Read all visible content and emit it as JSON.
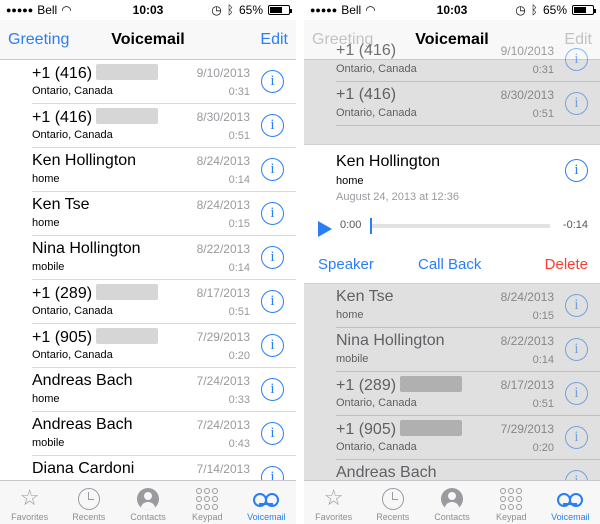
{
  "status": {
    "carrier": "Bell",
    "time": "10:03",
    "battery": "65%"
  },
  "left": {
    "nav": {
      "left": "Greeting",
      "title": "Voicemail",
      "right": "Edit"
    },
    "rows": [
      {
        "name": "+1 (416)",
        "blurred": true,
        "sub": "Ontario, Canada",
        "date": "9/10/2013",
        "dur": "0:31"
      },
      {
        "name": "+1 (416)",
        "blurred": true,
        "sub": "Ontario, Canada",
        "date": "8/30/2013",
        "dur": "0:51"
      },
      {
        "name": "Ken Hollington",
        "blurred": false,
        "sub": "home",
        "date": "8/24/2013",
        "dur": "0:14"
      },
      {
        "name": "Ken Tse",
        "blurred": false,
        "sub": "home",
        "date": "8/24/2013",
        "dur": "0:15"
      },
      {
        "name": "Nina Hollington",
        "blurred": false,
        "sub": "mobile",
        "date": "8/22/2013",
        "dur": "0:14"
      },
      {
        "name": "+1 (289)",
        "blurred": true,
        "sub": "Ontario, Canada",
        "date": "8/17/2013",
        "dur": "0:51"
      },
      {
        "name": "+1 (905)",
        "blurred": true,
        "sub": "Ontario, Canada",
        "date": "7/29/2013",
        "dur": "0:20"
      },
      {
        "name": "Andreas Bach",
        "blurred": false,
        "sub": "home",
        "date": "7/24/2013",
        "dur": "0:33"
      },
      {
        "name": "Andreas Bach",
        "blurred": false,
        "sub": "mobile",
        "date": "7/24/2013",
        "dur": "0:43"
      },
      {
        "name": "Diana Cardoni",
        "blurred": false,
        "sub": "",
        "date": "7/14/2013",
        "dur": ""
      }
    ]
  },
  "right": {
    "nav": {
      "left": "Greeting",
      "title": "Voicemail",
      "right": "Edit"
    },
    "top_rows": [
      {
        "name": "+1 (416)",
        "sub": "Ontario, Canada",
        "date": "9/10/2013",
        "dur": "0:31"
      },
      {
        "name": "+1 (416)",
        "sub": "Ontario, Canada",
        "date": "8/30/2013",
        "dur": "0:51"
      }
    ],
    "expanded": {
      "name": "Ken Hollington",
      "sub": "home",
      "received": "August 24, 2013 at 12:36",
      "position": "0:00",
      "remaining": "-0:14",
      "progress": 0.0,
      "speaker": "Speaker",
      "call_back": "Call Back",
      "delete": "Delete"
    },
    "bottom_rows": [
      {
        "name": "Ken Tse",
        "blurred": false,
        "sub": "home",
        "date": "8/24/2013",
        "dur": "0:15"
      },
      {
        "name": "Nina Hollington",
        "blurred": false,
        "sub": "mobile",
        "date": "8/22/2013",
        "dur": "0:14"
      },
      {
        "name": "+1 (289)",
        "blurred": true,
        "sub": "Ontario, Canada",
        "date": "8/17/2013",
        "dur": "0:51"
      },
      {
        "name": "+1 (905)",
        "blurred": true,
        "sub": "Ontario, Canada",
        "date": "7/29/2013",
        "dur": "0:20"
      },
      {
        "name": "Andreas Bach",
        "blurred": false,
        "sub": "",
        "date": "",
        "dur": ""
      }
    ]
  },
  "tabs": [
    {
      "label": "Favorites",
      "icon": "star-icon"
    },
    {
      "label": "Recents",
      "icon": "clock-icon"
    },
    {
      "label": "Contacts",
      "icon": "person-icon"
    },
    {
      "label": "Keypad",
      "icon": "keypad-icon"
    },
    {
      "label": "Voicemail",
      "icon": "voicemail-icon",
      "active": true
    }
  ],
  "colors": {
    "accent": "#2a7ef5",
    "delete": "#ff3b30",
    "muted": "#9a9a9f"
  }
}
